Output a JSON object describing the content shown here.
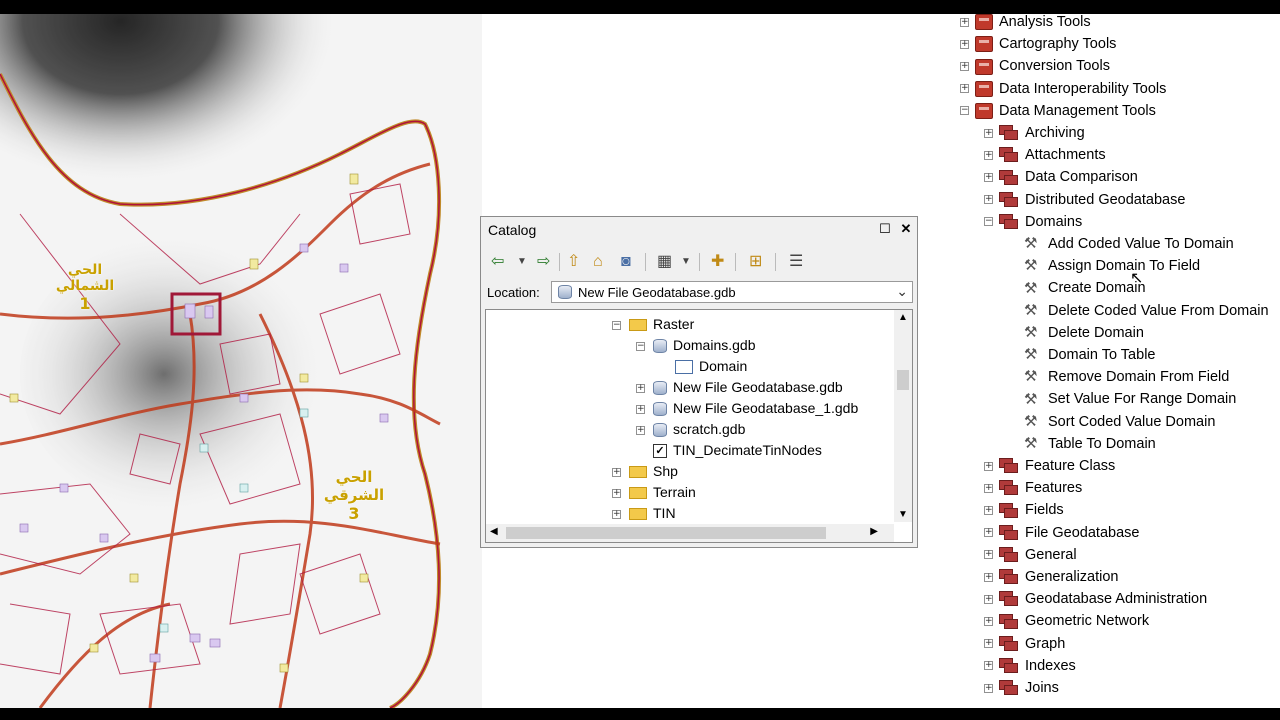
{
  "map": {
    "label_north": "الحي الشمالي",
    "label_north_num": "1",
    "label_east": "الحي الشرقي",
    "label_east_num": "3"
  },
  "catalog": {
    "title": "Catalog",
    "location_label": "Location:",
    "location_value": "New File Geodatabase.gdb",
    "tree": [
      {
        "label": "Raster",
        "type": "folder",
        "expander": "minus",
        "indent": 0
      },
      {
        "label": "Domains.gdb",
        "type": "gdb",
        "expander": "minus",
        "indent": 1
      },
      {
        "label": "Domain",
        "type": "table",
        "expander": "none",
        "indent": 2
      },
      {
        "label": "New File Geodatabase.gdb",
        "type": "gdb",
        "expander": "plus",
        "indent": 1
      },
      {
        "label": "New File Geodatabase_1.gdb",
        "type": "gdb",
        "expander": "plus",
        "indent": 1
      },
      {
        "label": "scratch.gdb",
        "type": "gdb",
        "expander": "plus",
        "indent": 1
      },
      {
        "label": "TIN_DecimateTinNodes",
        "type": "tin",
        "expander": "none",
        "indent": 1
      },
      {
        "label": "Shp",
        "type": "folder",
        "expander": "plus",
        "indent": 0
      },
      {
        "label": "Terrain",
        "type": "folder",
        "expander": "plus",
        "indent": 0
      },
      {
        "label": "TIN",
        "type": "folder",
        "expander": "plus",
        "indent": 0
      }
    ]
  },
  "toolbox_tree": [
    {
      "label": "Analysis Tools",
      "kind": "toolbox",
      "expander": "plus"
    },
    {
      "label": "Cartography Tools",
      "kind": "toolbox",
      "expander": "plus"
    },
    {
      "label": "Conversion Tools",
      "kind": "toolbox",
      "expander": "plus"
    },
    {
      "label": "Data Interoperability Tools",
      "kind": "toolbox",
      "expander": "plus"
    },
    {
      "label": "Data Management Tools",
      "kind": "toolbox",
      "expander": "minus"
    },
    {
      "label": "Archiving",
      "kind": "toolset",
      "expander": "plus"
    },
    {
      "label": "Attachments",
      "kind": "toolset",
      "expander": "plus"
    },
    {
      "label": "Data Comparison",
      "kind": "toolset",
      "expander": "plus"
    },
    {
      "label": "Distributed Geodatabase",
      "kind": "toolset",
      "expander": "plus"
    },
    {
      "label": "Domains",
      "kind": "toolset",
      "expander": "minus"
    },
    {
      "label": "Add Coded Value To Domain",
      "kind": "tool",
      "expander": "none"
    },
    {
      "label": "Assign Domain To Field",
      "kind": "tool",
      "expander": "none"
    },
    {
      "label": "Create Domain",
      "kind": "tool",
      "expander": "none"
    },
    {
      "label": "Delete Coded Value From Domain",
      "kind": "tool",
      "expander": "none"
    },
    {
      "label": "Delete Domain",
      "kind": "tool",
      "expander": "none"
    },
    {
      "label": "Domain To Table",
      "kind": "tool",
      "expander": "none"
    },
    {
      "label": "Remove Domain From Field",
      "kind": "tool",
      "expander": "none"
    },
    {
      "label": "Set Value For Range Domain",
      "kind": "tool",
      "expander": "none"
    },
    {
      "label": "Sort Coded Value Domain",
      "kind": "tool",
      "expander": "none"
    },
    {
      "label": "Table To Domain",
      "kind": "tool",
      "expander": "none"
    },
    {
      "label": "Feature Class",
      "kind": "toolset",
      "expander": "plus"
    },
    {
      "label": "Features",
      "kind": "toolset",
      "expander": "plus"
    },
    {
      "label": "Fields",
      "kind": "toolset",
      "expander": "plus"
    },
    {
      "label": "File Geodatabase",
      "kind": "toolset",
      "expander": "plus"
    },
    {
      "label": "General",
      "kind": "toolset",
      "expander": "plus"
    },
    {
      "label": "Generalization",
      "kind": "toolset",
      "expander": "plus"
    },
    {
      "label": "Geodatabase Administration",
      "kind": "toolset",
      "expander": "plus"
    },
    {
      "label": "Geometric Network",
      "kind": "toolset",
      "expander": "plus"
    },
    {
      "label": "Graph",
      "kind": "toolset",
      "expander": "plus"
    },
    {
      "label": "Indexes",
      "kind": "toolset",
      "expander": "plus"
    },
    {
      "label": "Joins",
      "kind": "toolset",
      "expander": "plus"
    }
  ]
}
